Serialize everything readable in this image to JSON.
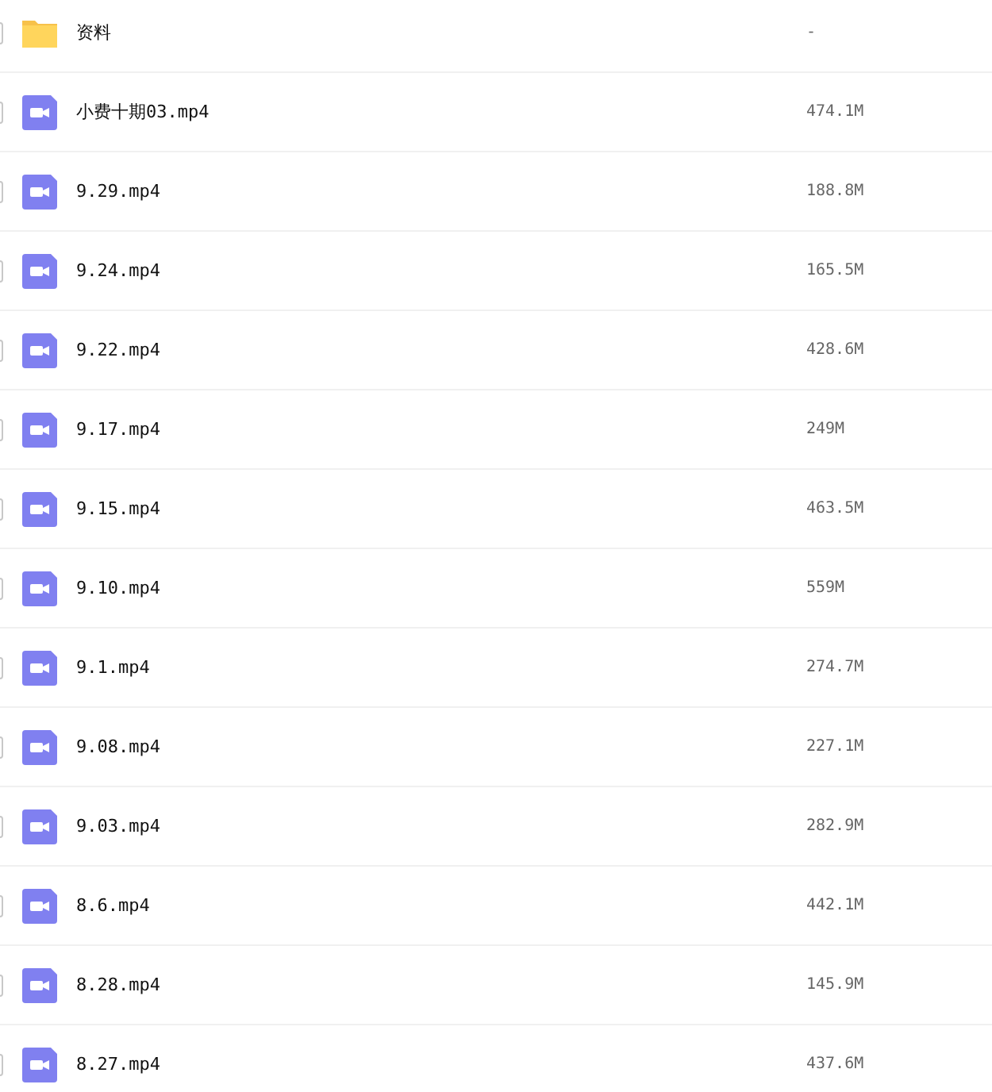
{
  "files": [
    {
      "kind": "folder",
      "name": "资料",
      "size": "-",
      "checked": false
    },
    {
      "kind": "video",
      "name": "小费十期03.mp4",
      "size": "474.1M",
      "checked": false
    },
    {
      "kind": "video",
      "name": "9.29.mp4",
      "size": "188.8M",
      "checked": false
    },
    {
      "kind": "video",
      "name": "9.24.mp4",
      "size": "165.5M",
      "checked": false
    },
    {
      "kind": "video",
      "name": "9.22.mp4",
      "size": "428.6M",
      "checked": false
    },
    {
      "kind": "video",
      "name": "9.17.mp4",
      "size": "249M",
      "checked": false
    },
    {
      "kind": "video",
      "name": "9.15.mp4",
      "size": "463.5M",
      "checked": false
    },
    {
      "kind": "video",
      "name": "9.10.mp4",
      "size": "559M",
      "checked": false
    },
    {
      "kind": "video",
      "name": "9.1.mp4",
      "size": "274.7M",
      "checked": false
    },
    {
      "kind": "video",
      "name": "9.08.mp4",
      "size": "227.1M",
      "checked": false
    },
    {
      "kind": "video",
      "name": "9.03.mp4",
      "size": "282.9M",
      "checked": false
    },
    {
      "kind": "video",
      "name": "8.6.mp4",
      "size": "442.1M",
      "checked": false
    },
    {
      "kind": "video",
      "name": "8.28.mp4",
      "size": "145.9M",
      "checked": false
    },
    {
      "kind": "video",
      "name": "8.27.mp4",
      "size": "437.6M",
      "checked": false
    }
  ]
}
